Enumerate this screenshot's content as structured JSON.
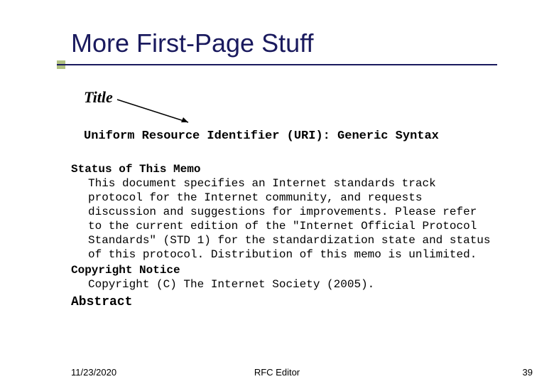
{
  "slide": {
    "title": "More First-Page Stuff"
  },
  "annotation": {
    "label": "Title"
  },
  "document": {
    "title": "Uniform Resource Identifier (URI): Generic Syntax",
    "sections": {
      "status_heading": "Status of This Memo",
      "status_body": "This document specifies an Internet standards track protocol for the Internet community, and requests discussion and suggestions for improvements. Please refer to the current edition of the \"Internet Official Protocol Standards\" (STD 1) for the standardization state and status of this protocol. Distribution of this memo is unlimited.",
      "copyright_heading": "Copyright Notice",
      "copyright_body": "Copyright (C) The Internet Society (2005).",
      "abstract_heading": "Abstract"
    }
  },
  "footer": {
    "date": "11/23/2020",
    "center": "RFC Editor",
    "page": "39"
  }
}
